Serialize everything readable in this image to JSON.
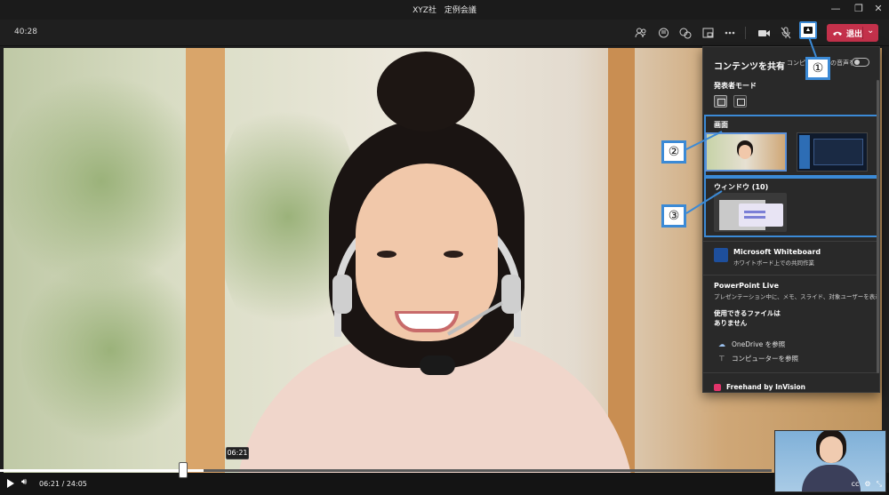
{
  "window": {
    "title": "XYZ社　定例会議",
    "minimize": "—",
    "maximize": "❐",
    "close": "✕"
  },
  "toolbar": {
    "timer": "40:28",
    "leave_label": "退出",
    "icons": [
      "people-icon",
      "chat-icon",
      "reactions-icon",
      "rooms-icon",
      "more-icon",
      "camera-icon",
      "mic-muted-icon",
      "share-icon"
    ],
    "accent": "#3b8ad6",
    "leave_color": "#c4314b"
  },
  "share_panel": {
    "title": "コンテンツを共有",
    "include_audio": "コンピューターの音声を含む",
    "presenter_mode": "発表者モード",
    "screen_label": "画面",
    "window_label": "ウィンドウ (10)",
    "whiteboard_title": "Microsoft Whiteboard",
    "whiteboard_sub": "ホワイトボード上での共同作業",
    "powerpoint_title": "PowerPoint Live",
    "powerpoint_sub": "プレゼンテーション中に、メモ、スライド、対象ユーザーを表示します",
    "no_files": "使用できるファイルはありません",
    "onedrive": "OneDrive を参照",
    "computer": "コンピューターを参照",
    "freehand": "Freehand by InVision"
  },
  "callouts": {
    "one": "①",
    "two": "②",
    "three": "③"
  },
  "playback": {
    "position": "06:21",
    "duration": "24:05",
    "time_display": "06:21 / 24:05",
    "progress_fraction": 0.264
  }
}
